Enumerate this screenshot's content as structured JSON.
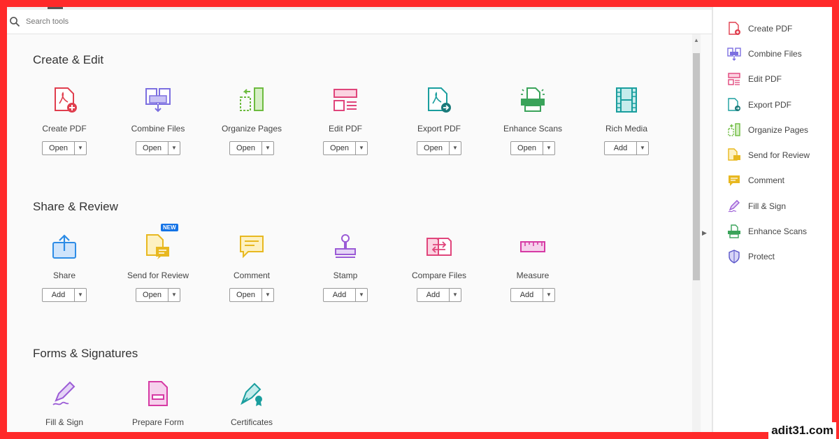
{
  "search": {
    "placeholder": "Search tools"
  },
  "sections": [
    {
      "title": "Create & Edit",
      "tools": [
        {
          "name": "Create PDF",
          "button": "Open"
        },
        {
          "name": "Combine Files",
          "button": "Open"
        },
        {
          "name": "Organize Pages",
          "button": "Open"
        },
        {
          "name": "Edit PDF",
          "button": "Open"
        },
        {
          "name": "Export PDF",
          "button": "Open"
        },
        {
          "name": "Enhance Scans",
          "button": "Open"
        },
        {
          "name": "Rich Media",
          "button": "Add"
        }
      ]
    },
    {
      "title": "Share & Review",
      "tools": [
        {
          "name": "Share",
          "button": "Add"
        },
        {
          "name": "Send for Review",
          "button": "Open",
          "badge": "NEW"
        },
        {
          "name": "Comment",
          "button": "Open"
        },
        {
          "name": "Stamp",
          "button": "Add"
        },
        {
          "name": "Compare Files",
          "button": "Add"
        },
        {
          "name": "Measure",
          "button": "Add"
        }
      ]
    },
    {
      "title": "Forms & Signatures",
      "tools": [
        {
          "name": "Fill & Sign"
        },
        {
          "name": "Prepare Form"
        },
        {
          "name": "Certificates"
        }
      ]
    }
  ],
  "right_panel": {
    "items": [
      {
        "label": "Create PDF",
        "icon": "create-pdf-icon"
      },
      {
        "label": "Combine Files",
        "icon": "combine-files-icon"
      },
      {
        "label": "Edit PDF",
        "icon": "edit-pdf-icon"
      },
      {
        "label": "Export PDF",
        "icon": "export-pdf-icon"
      },
      {
        "label": "Organize Pages",
        "icon": "organize-pages-icon"
      },
      {
        "label": "Send for Review",
        "icon": "send-for-review-icon"
      },
      {
        "label": "Comment",
        "icon": "comment-icon"
      },
      {
        "label": "Fill & Sign",
        "icon": "fill-sign-icon"
      },
      {
        "label": "Enhance Scans",
        "icon": "enhance-scans-icon"
      },
      {
        "label": "Protect",
        "icon": "protect-icon"
      }
    ]
  },
  "watermark": "adit31.com",
  "colors": {
    "red": "#e03e4e",
    "purple": "#7c6fe0",
    "green": "#6dbb3f",
    "pink": "#e0457b",
    "teal": "#1a9e9e",
    "blue": "#2d8ce6",
    "yellow": "#e8b820",
    "violet": "#9b5bd6",
    "magenta": "#d63aa4",
    "frame": "#ff2a2a"
  }
}
